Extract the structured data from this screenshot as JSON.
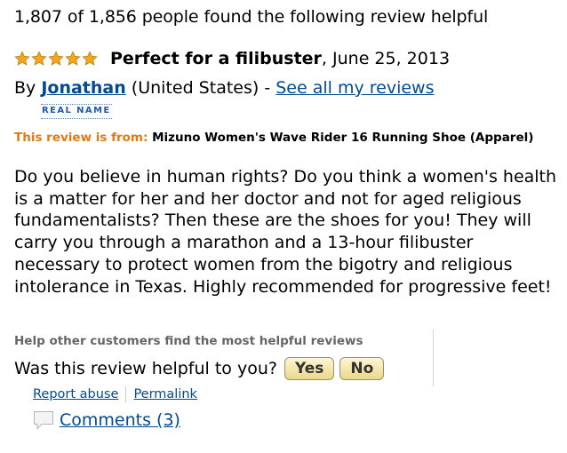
{
  "helpful_count_text": "1,807 of 1,856 people found the following review helpful",
  "rating": {
    "stars": 5,
    "max_stars": 5,
    "color": "#f0a81f"
  },
  "review": {
    "title": "Perfect for a filibuster",
    "date": ", June 25, 2013",
    "body": "Do you believe in human rights? Do you think a women's health is a matter for her and her doctor and not for aged religious fundamentalists? Then these are the shoes for you! They will carry you through a marathon and a 13-hour filibuster necessary to protect women from the bigotry and religious intolerance in Texas. Highly recommended for progressive feet!"
  },
  "author": {
    "by_label": "By ",
    "name": "Jonathan",
    "location": " (United States) - ",
    "see_all_link": "See all my reviews",
    "badge": "REAL NAME"
  },
  "product": {
    "from_label": "This review is from:",
    "name": " Mizuno Women's Wave Rider 16 Running Shoe (Apparel)"
  },
  "voting": {
    "help_others": "Help other customers find the most helpful reviews",
    "question": "Was this review helpful to you?",
    "yes_label": "Yes",
    "no_label": "No"
  },
  "links": {
    "report_abuse": "Report abuse",
    "permalink": "Permalink",
    "comments": "Comments (3)"
  },
  "colors": {
    "link": "#004b91",
    "from_label": "#e47911",
    "badge": "#1e5bb0",
    "button_bg": "#e9d98a"
  }
}
